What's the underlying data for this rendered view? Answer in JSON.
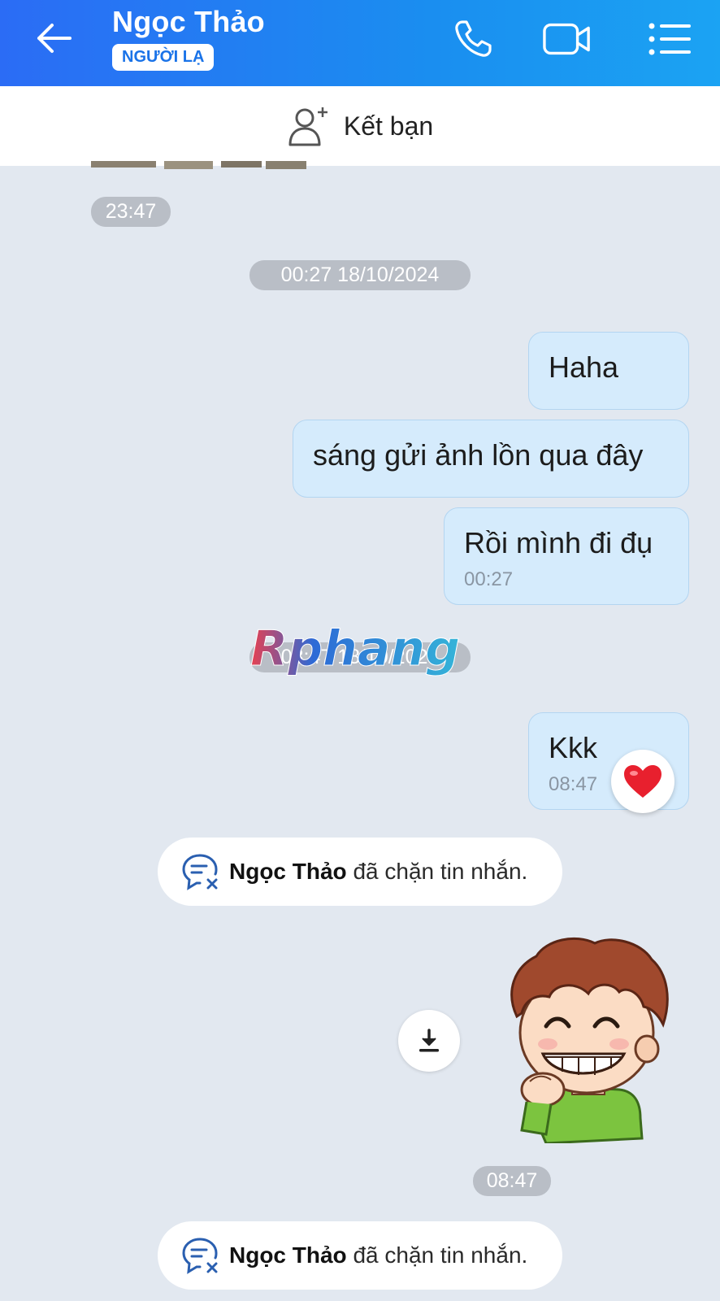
{
  "header": {
    "contact_name": "Ngọc Thảo",
    "badge": "NGƯỜI LẠ",
    "colors": {
      "gradient_start": "#2b6cf5",
      "gradient_end": "#1ba3f3"
    },
    "icons": [
      "back-arrow-icon",
      "phone-icon",
      "video-call-icon",
      "menu-list-icon"
    ]
  },
  "add_friend": {
    "label": "Kết bạn",
    "icon": "add-friend-icon"
  },
  "messages": {
    "prev_time": "23:47",
    "date_sep_1": "00:27 18/10/2024",
    "out_1": "Haha",
    "out_2": "sáng gửi ảnh lồn qua đây",
    "out_3": "Rồi mình đi đụ",
    "out_3_time": "00:27",
    "date_sep_2": "08:47 18/10/2024",
    "out_4": "Kkk",
    "out_4_time": "08:47",
    "out_4_reaction": "heart-icon",
    "sticker_time": "08:47"
  },
  "system": {
    "blocked_1": {
      "name": "Ngọc Thảo",
      "text": "đã chặn tin nhắn."
    },
    "blocked_2": {
      "name": "Ngọc Thảo",
      "text": "đã chặn tin nhắn."
    }
  },
  "watermark": {
    "text": "Rphang"
  },
  "colors": {
    "chat_bg": "#e2e8f0",
    "outgoing_bubble": "#d5ebfc",
    "time_pill": "#b9bec6",
    "accent": "#1a73e8"
  }
}
